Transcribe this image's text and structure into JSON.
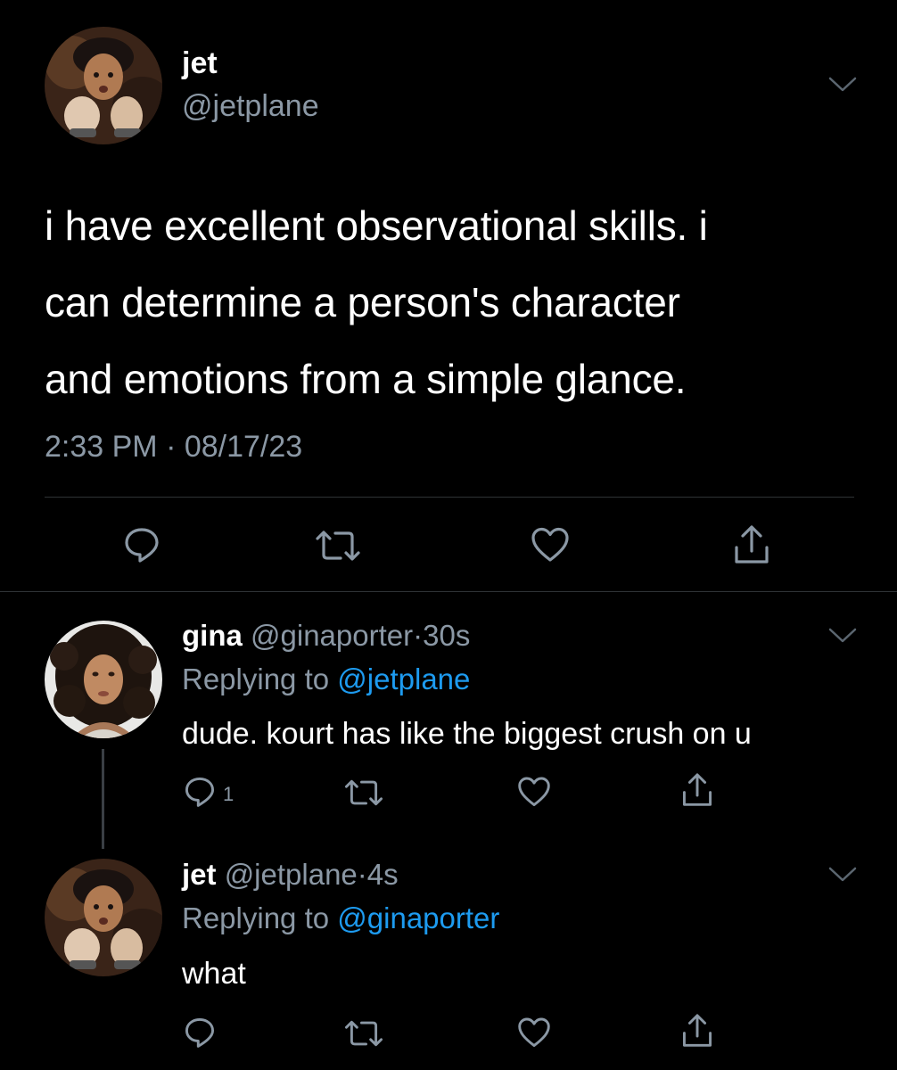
{
  "main_tweet": {
    "display_name": "jet",
    "handle": "@jetplane",
    "text_lines": [
      "i have excellent observational skills. i",
      "can determine a person's character",
      "and emotions from a simple glance."
    ],
    "timestamp": "2:33 PM · 08/17/23",
    "actions": [
      "reply-icon",
      "retweet-icon",
      "like-icon",
      "share-icon"
    ]
  },
  "replies": [
    {
      "display_name": "gina",
      "handle": "@ginaporter",
      "separator": "·",
      "age": "30s",
      "replying_prefix": "Replying to",
      "replying_handle": "@jetplane",
      "text": "dude. kourt has like the biggest crush on u",
      "reply_count": "1"
    },
    {
      "display_name": "jet",
      "handle": "@jetplane",
      "separator": "·",
      "age": "4s",
      "replying_prefix": "Replying to",
      "replying_handle": "@ginaporter",
      "text": "what",
      "reply_count": ""
    }
  ],
  "colors": {
    "background": "#000000",
    "text": "#ffffff",
    "secondary_text": "#8b98a5",
    "link": "#1d9bf0",
    "divider": "#2f3336"
  }
}
